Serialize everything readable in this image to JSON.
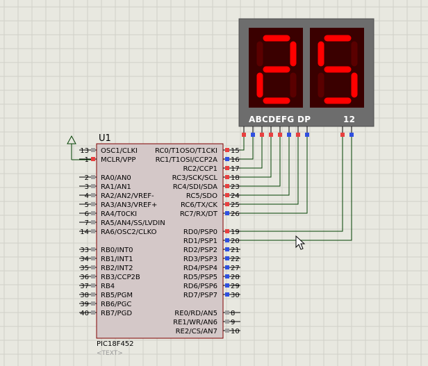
{
  "chip": {
    "ref": "U1",
    "part": "PIC18F452",
    "text_placeholder": "<TEXT>"
  },
  "display": {
    "digits": [
      "2",
      "5"
    ],
    "segment_label": "ABCDEFG DP",
    "common_label": "12",
    "segment_color": "#ff0000",
    "body_color": "#6d6d6d"
  },
  "left_pins": [
    {
      "num": "13",
      "name": "OSC1/CLKI"
    },
    {
      "num": "1",
      "name": "MCLR/VPP"
    },
    {
      "num": "2",
      "name": "RA0/AN0"
    },
    {
      "num": "3",
      "name": "RA1/AN1"
    },
    {
      "num": "4",
      "name": "RA2/AN2/VREF-"
    },
    {
      "num": "5",
      "name": "RA3/AN3/VREF+"
    },
    {
      "num": "6",
      "name": "RA4/T0CKI"
    },
    {
      "num": "7",
      "name": "RA5/AN4/SS/LVDIN"
    },
    {
      "num": "14",
      "name": "RA6/OSC2/CLKO"
    },
    {
      "num": "33",
      "name": "RB0/INT0"
    },
    {
      "num": "34",
      "name": "RB1/INT1"
    },
    {
      "num": "35",
      "name": "RB2/INT2"
    },
    {
      "num": "36",
      "name": "RB3/CCP2B"
    },
    {
      "num": "37",
      "name": "RB4"
    },
    {
      "num": "38",
      "name": "RB5/PGM"
    },
    {
      "num": "39",
      "name": "RB6/PGC"
    },
    {
      "num": "40",
      "name": "RB7/PGD"
    }
  ],
  "right_pins": [
    {
      "num": "15",
      "name": "RC0/T1OSO/T1CKI"
    },
    {
      "num": "16",
      "name": "RC1/T1OSI/CCP2A"
    },
    {
      "num": "17",
      "name": "RC2/CCP1"
    },
    {
      "num": "18",
      "name": "RC3/SCK/SCL"
    },
    {
      "num": "23",
      "name": "RC4/SDI/SDA"
    },
    {
      "num": "24",
      "name": "RC5/SDO"
    },
    {
      "num": "25",
      "name": "RC6/TX/CK"
    },
    {
      "num": "26",
      "name": "RC7/RX/DT"
    },
    {
      "num": "19",
      "name": "RD0/PSP0"
    },
    {
      "num": "20",
      "name": "RD1/PSP1"
    },
    {
      "num": "21",
      "name": "RD2/PSP2"
    },
    {
      "num": "22",
      "name": "RD3/PSP3"
    },
    {
      "num": "27",
      "name": "RD4/PSP4"
    },
    {
      "num": "28",
      "name": "RD5/PSP5"
    },
    {
      "num": "29",
      "name": "RD6/PSP6"
    },
    {
      "num": "30",
      "name": "RD7/PSP7"
    },
    {
      "num": "8",
      "name": "RE0/RD/AN5"
    },
    {
      "num": "9",
      "name": "RE1/WR/AN6"
    },
    {
      "num": "10",
      "name": "RE2/CS/AN7"
    }
  ],
  "colors": {
    "wire": "#004000",
    "chip_fill": "#d4c8c8",
    "chip_border": "#800000",
    "pin_high": "#e84040",
    "pin_low": "#3050e0",
    "pin_idle": "#a0a0a0",
    "grid": "#d0d0c8"
  }
}
